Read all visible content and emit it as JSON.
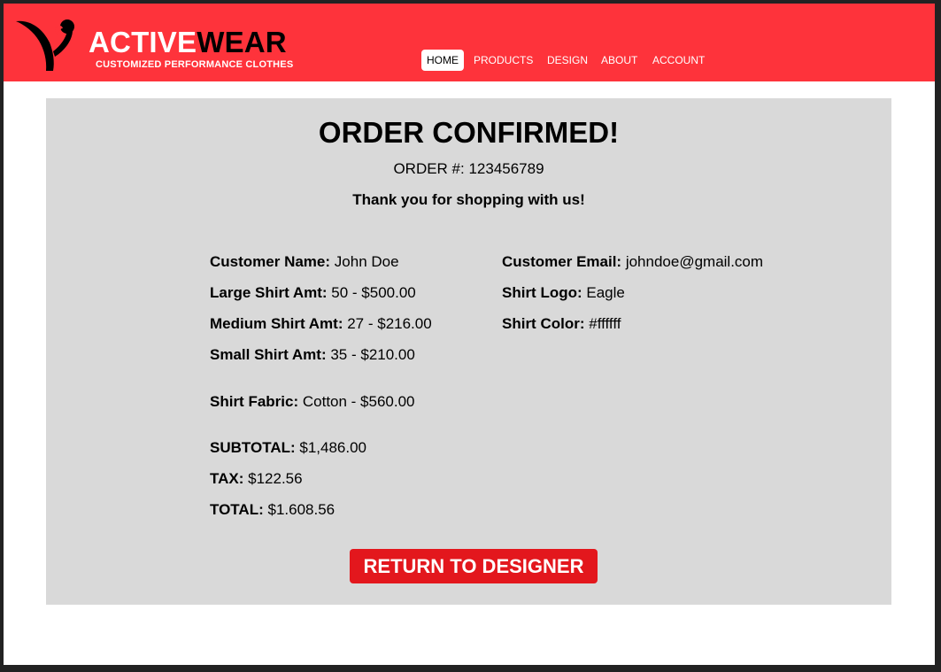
{
  "brand": {
    "name_part1": "ACTIVE",
    "name_part2": "WEAR",
    "tagline": "CUSTOMIZED PERFORMANCE CLOTHES",
    "logo_icon": "runner-swoosh-logo-icon"
  },
  "nav": {
    "items": [
      {
        "label": "HOME",
        "active": true
      },
      {
        "label": "PRODUCTS",
        "active": false
      },
      {
        "label": "DESIGN",
        "active": false
      },
      {
        "label": "ABOUT",
        "active": false
      },
      {
        "label": "ACCOUNT",
        "active": false
      }
    ]
  },
  "confirmation": {
    "title": "ORDER CONFIRMED!",
    "order_number": "ORDER #: 123456789",
    "thanks": "Thank you for shopping with us!"
  },
  "details": {
    "customer_name": {
      "label": "Customer Name:",
      "value": "John Doe"
    },
    "large_shirt": {
      "label": "Large Shirt Amt:",
      "value": "50 - $500.00"
    },
    "medium_shirt": {
      "label": "Medium Shirt Amt:",
      "value": "27 - $216.00"
    },
    "small_shirt": {
      "label": "Small Shirt Amt:",
      "value": "35 - $210.00"
    },
    "shirt_fabric": {
      "label": "Shirt Fabric:",
      "value": "Cotton - $560.00"
    },
    "customer_email": {
      "label": "Customer Email:",
      "value": "johndoe@gmail.com"
    },
    "shirt_logo": {
      "label": "Shirt Logo:",
      "value": "Eagle"
    },
    "shirt_color": {
      "label": "Shirt Color:",
      "value": "#ffffff"
    }
  },
  "totals": {
    "subtotal": {
      "label": "SUBTOTAL:",
      "value": "$1,486.00"
    },
    "tax": {
      "label": "TAX:",
      "value": "$122.56"
    },
    "total": {
      "label": "TOTAL:",
      "value": "$1.608.56"
    }
  },
  "actions": {
    "return_label": "RETURN TO DESIGNER"
  },
  "colors": {
    "header_red": "#fe333b",
    "button_red": "#e3171d",
    "panel_gray": "#d9d9d9"
  }
}
